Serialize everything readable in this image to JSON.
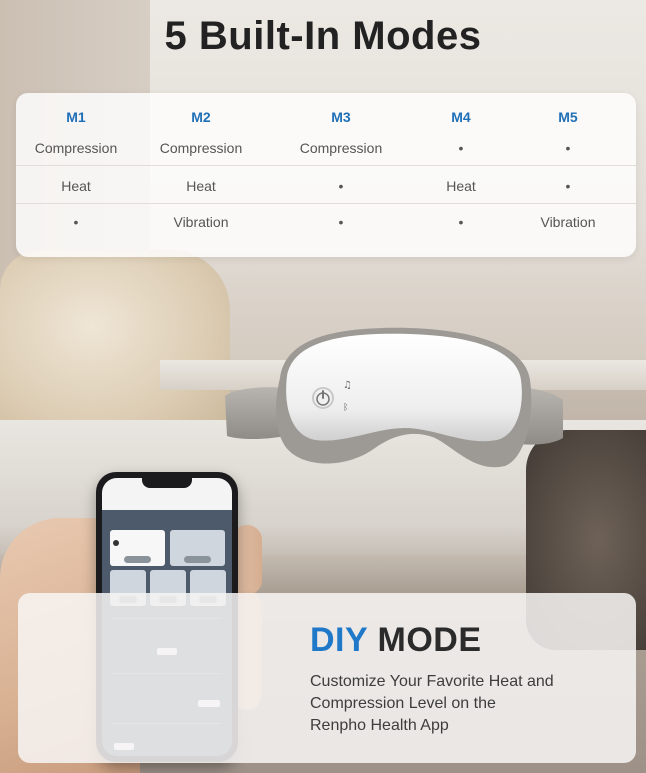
{
  "headline": "5 Built-In Modes",
  "modes": {
    "headers": [
      "M1",
      "M2",
      "M3",
      "M4",
      "M5"
    ],
    "rows": [
      [
        "Compression",
        "Compression",
        "Compression",
        "•",
        "•"
      ],
      [
        "Heat",
        "Heat",
        "•",
        "Heat",
        "•"
      ],
      [
        "•",
        "Vibration",
        "•",
        "•",
        "Vibration"
      ]
    ]
  },
  "diy": {
    "title_accent": "DIY",
    "title_rest": " MODE",
    "description_line1": "Customize Your Favorite Heat and",
    "description_line2": "Compression Level on the",
    "description_line3": "Renpho Health App"
  },
  "colors": {
    "accent": "#1f78c8",
    "header_blue": "#1f6fb7"
  },
  "icons": [
    "power-icon",
    "music-icon",
    "bluetooth-icon"
  ]
}
